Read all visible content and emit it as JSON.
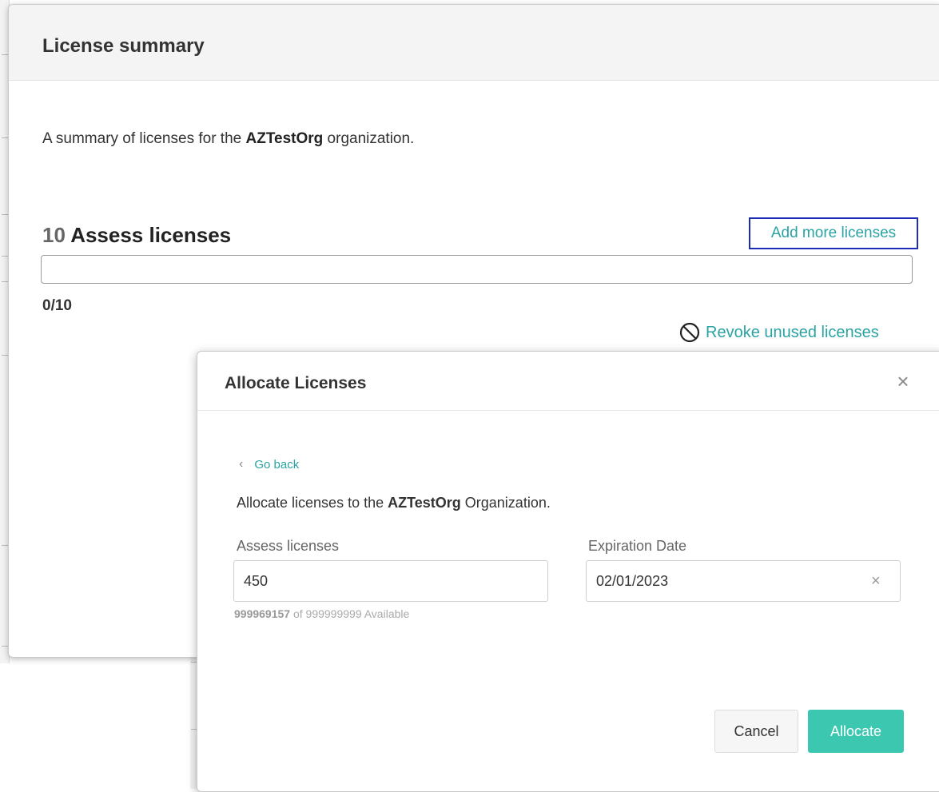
{
  "summary": {
    "title": "License summary",
    "desc_prefix": "A summary of licenses for the ",
    "org_name": "AZTestOrg",
    "desc_suffix": " organization.",
    "license_count": "10",
    "license_type": "Assess licenses",
    "add_more_label": "Add more licenses",
    "usage_label": "0/10",
    "usage_fraction": 0,
    "revoke_label": "Revoke unused licenses"
  },
  "allocate": {
    "title": "Allocate Licenses",
    "close_icon": "close-icon",
    "go_back_label": "Go back",
    "desc_prefix": "Allocate licenses to the ",
    "org_name": "AZTestOrg",
    "desc_suffix": " Organization.",
    "licenses_label": "Assess licenses",
    "licenses_value": "450",
    "available_count": "999969157",
    "available_suffix": " of 999999999 Available",
    "expiration_label": "Expiration Date",
    "expiration_value": "02/01/2023",
    "cancel_label": "Cancel",
    "allocate_label": "Allocate"
  },
  "colors": {
    "accent": "#2aa3a3",
    "primary_button": "#3cc7b0",
    "focus_outline": "#1e2bb5"
  }
}
